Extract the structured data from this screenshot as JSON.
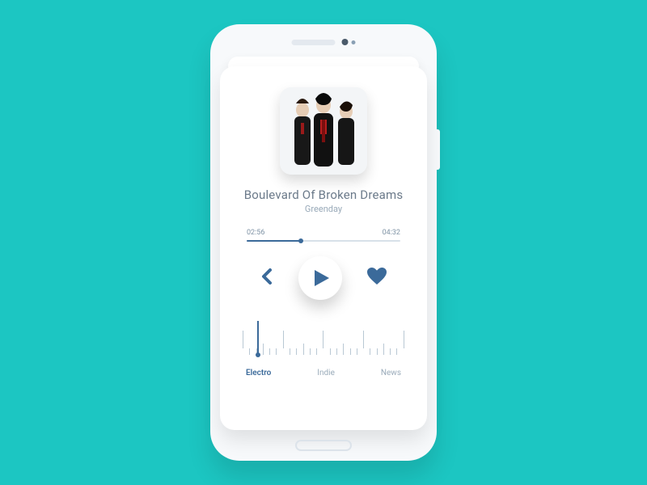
{
  "track": {
    "title": "Boulevard Of Broken Dreams",
    "artist": "Greenday"
  },
  "progress": {
    "elapsed": "02:56",
    "total": "04:32",
    "fraction": 0.35
  },
  "tuner": {
    "stations": [
      "Electro",
      "Indie",
      "News"
    ],
    "active_index": 0
  },
  "colors": {
    "background": "#1cc6c2",
    "accent": "#3b6a9a"
  }
}
